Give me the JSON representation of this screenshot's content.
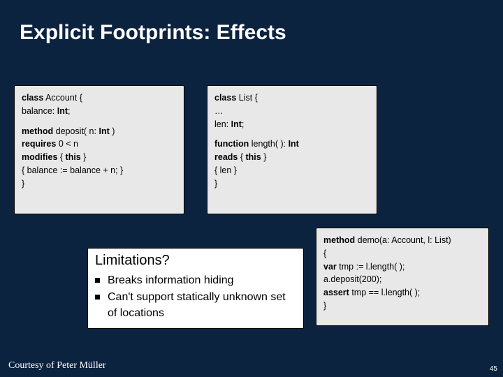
{
  "title": "Explicit Footprints: Effects",
  "code_left": {
    "l1a": "class",
    "l1b": " Account {",
    "l2a": " balance: ",
    "l2b": "Int",
    "l2c": ";",
    "l3a": "  method",
    "l3b": " deposit( n: ",
    "l3c": "Int",
    "l3d": " )",
    "l4a": "    requires",
    "l4b": " 0 < n",
    "l5a": "    modifies",
    "l5b": " { ",
    "l5c": "this",
    "l5d": " }",
    "l6": "  { balance := balance + n; }",
    "l7": "}"
  },
  "code_right": {
    "l1a": "class",
    "l1b": " List {",
    "l2": "  …",
    "l3a": "  len: ",
    "l3b": "Int",
    "l3c": ";",
    "l4a": "  function",
    "l4b": " length( ): ",
    "l4c": "Int",
    "l5a": "    reads",
    "l5b": " { ",
    "l5c": "this",
    "l5d": " }",
    "l6": "  { len }",
    "l7": "}"
  },
  "code_demo": {
    "l1a": "method",
    "l1b": " demo(a: Account, l: List)",
    "l2": "{",
    "l3a": "  var",
    "l3b": " tmp := l.length( );",
    "l4": "  a.deposit(200);",
    "l5a": "  assert",
    "l5b": " tmp == l.length( );",
    "l6": "}"
  },
  "overlay": {
    "title": "Limitations?",
    "item1": "Breaks information hiding",
    "item2": "Can't support statically unknown set of locations"
  },
  "footer": {
    "left": "Courtesy of Peter Müller",
    "right": "45"
  }
}
